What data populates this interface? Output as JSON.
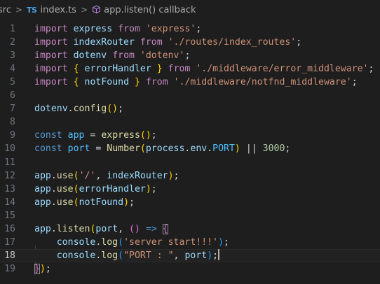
{
  "breadcrumb": {
    "folder": "src",
    "file_icon": "TS",
    "file": "index.ts",
    "symbol_icon": "method-cube-icon",
    "symbol": "app.listen() callback",
    "separator": ">"
  },
  "editor": {
    "current_line": 18,
    "lines": [
      {
        "n": "1",
        "tokens": [
          [
            "kw",
            "import"
          ],
          [
            "",
            " "
          ],
          [
            "vr",
            "express"
          ],
          [
            "",
            " "
          ],
          [
            "kw",
            "from"
          ],
          [
            "",
            " "
          ],
          [
            "st",
            "'express'"
          ],
          [
            "",
            ";"
          ]
        ]
      },
      {
        "n": "2",
        "tokens": [
          [
            "kw",
            "import"
          ],
          [
            "",
            " "
          ],
          [
            "vr",
            "indexRouter"
          ],
          [
            "",
            " "
          ],
          [
            "kw",
            "from"
          ],
          [
            "",
            " "
          ],
          [
            "st",
            "'./routes/index_routes'"
          ],
          [
            "",
            ";"
          ]
        ]
      },
      {
        "n": "3",
        "tokens": [
          [
            "kw",
            "import"
          ],
          [
            "",
            " "
          ],
          [
            "vr",
            "dotenv"
          ],
          [
            "",
            " "
          ],
          [
            "kw",
            "from"
          ],
          [
            "",
            " "
          ],
          [
            "st",
            "'dotenv'"
          ],
          [
            "",
            ";"
          ]
        ]
      },
      {
        "n": "4",
        "tokens": [
          [
            "kw",
            "import"
          ],
          [
            "",
            " "
          ],
          [
            "b1",
            "{"
          ],
          [
            "",
            " "
          ],
          [
            "vr",
            "errorHandler"
          ],
          [
            "",
            " "
          ],
          [
            "b1",
            "}"
          ],
          [
            "",
            " "
          ],
          [
            "kw",
            "from"
          ],
          [
            "",
            " "
          ],
          [
            "st",
            "'./middleware/error_middleware'"
          ],
          [
            "",
            ";"
          ]
        ]
      },
      {
        "n": "5",
        "tokens": [
          [
            "kw",
            "import"
          ],
          [
            "",
            " "
          ],
          [
            "b1",
            "{"
          ],
          [
            "",
            " "
          ],
          [
            "vr",
            "notFound"
          ],
          [
            "",
            " "
          ],
          [
            "b1",
            "}"
          ],
          [
            "",
            " "
          ],
          [
            "kw",
            "from"
          ],
          [
            "",
            " "
          ],
          [
            "st",
            "'./middleware/notfnd_middleware'"
          ],
          [
            "",
            ";"
          ]
        ]
      },
      {
        "n": "6",
        "tokens": []
      },
      {
        "n": "7",
        "tokens": [
          [
            "vr",
            "dotenv"
          ],
          [
            "",
            "."
          ],
          [
            "fn",
            "config"
          ],
          [
            "b1",
            "()"
          ],
          [
            "",
            ";"
          ]
        ]
      },
      {
        "n": "8",
        "tokens": []
      },
      {
        "n": "9",
        "tokens": [
          [
            "dk",
            "const"
          ],
          [
            "",
            " "
          ],
          [
            "cn",
            "app"
          ],
          [
            "",
            " = "
          ],
          [
            "fn",
            "express"
          ],
          [
            "b1",
            "()"
          ],
          [
            "",
            ";"
          ]
        ]
      },
      {
        "n": "10",
        "tokens": [
          [
            "dk",
            "const"
          ],
          [
            "",
            " "
          ],
          [
            "cn",
            "port"
          ],
          [
            "",
            " = "
          ],
          [
            "fn",
            "Number"
          ],
          [
            "b1",
            "("
          ],
          [
            "vr",
            "process"
          ],
          [
            "",
            "."
          ],
          [
            "vr",
            "env"
          ],
          [
            "",
            "."
          ],
          [
            "cn",
            "PORT"
          ],
          [
            "b1",
            ")"
          ],
          [
            "",
            "",
            " "
          ],
          [
            "",
            ""
          ],
          [
            "",
            " || "
          ],
          [
            "nm",
            "3000"
          ],
          [
            "",
            ";"
          ]
        ]
      },
      {
        "n": "11",
        "tokens": []
      },
      {
        "n": "12",
        "tokens": [
          [
            "vr",
            "app"
          ],
          [
            "",
            "."
          ],
          [
            "fn",
            "use"
          ],
          [
            "b1",
            "("
          ],
          [
            "st",
            "'/'"
          ],
          [
            "",
            ", "
          ],
          [
            "vr",
            "indexRouter"
          ],
          [
            "b1",
            ")"
          ],
          [
            "",
            ";"
          ]
        ]
      },
      {
        "n": "13",
        "tokens": [
          [
            "vr",
            "app"
          ],
          [
            "",
            "."
          ],
          [
            "fn",
            "use"
          ],
          [
            "b1",
            "("
          ],
          [
            "vr",
            "errorHandler"
          ],
          [
            "b1",
            ")"
          ],
          [
            "",
            ";"
          ]
        ]
      },
      {
        "n": "14",
        "tokens": [
          [
            "vr",
            "app"
          ],
          [
            "",
            "."
          ],
          [
            "fn",
            "use"
          ],
          [
            "b1",
            "("
          ],
          [
            "vr",
            "notFound"
          ],
          [
            "b1",
            ")"
          ],
          [
            "",
            ";"
          ]
        ]
      },
      {
        "n": "15",
        "tokens": []
      },
      {
        "n": "16",
        "tokens": [
          [
            "vr",
            "app"
          ],
          [
            "",
            "."
          ],
          [
            "fn",
            "listen"
          ],
          [
            "b1",
            "("
          ],
          [
            "vr",
            "port"
          ],
          [
            "",
            ", "
          ],
          [
            "b2",
            "()"
          ],
          [
            "",
            " "
          ],
          [
            "dk",
            "=>"
          ],
          [
            "",
            " "
          ],
          [
            "b2 bm",
            "{"
          ]
        ]
      },
      {
        "n": "17",
        "tokens": [
          [
            "",
            "    "
          ],
          [
            "vr",
            "console"
          ],
          [
            "",
            "."
          ],
          [
            "fn",
            "log"
          ],
          [
            "b3",
            "("
          ],
          [
            "st",
            "'server start!!!'"
          ],
          [
            "b3",
            ")"
          ],
          [
            "",
            ";"
          ]
        ]
      },
      {
        "n": "18",
        "tokens": [
          [
            "",
            "    "
          ],
          [
            "vr",
            "console"
          ],
          [
            "",
            "."
          ],
          [
            "fn",
            "log"
          ],
          [
            "b3",
            "("
          ],
          [
            "st",
            "\"PORT : \""
          ],
          [
            "",
            ", "
          ],
          [
            "vr",
            "port"
          ],
          [
            "b3",
            ")"
          ],
          [
            "",
            ";"
          ]
        ]
      },
      {
        "n": "19",
        "tokens": [
          [
            "b2 bm",
            "}"
          ],
          [
            "b1",
            ")"
          ],
          [
            "",
            ";"
          ]
        ]
      }
    ]
  }
}
